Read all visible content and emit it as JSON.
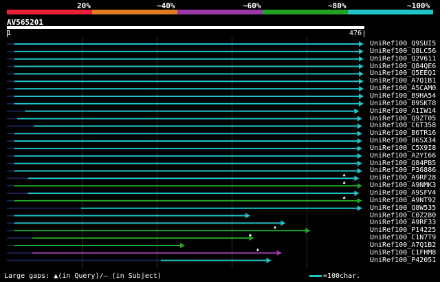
{
  "header": {
    "percent_labels": [
      "20%",
      "~40%",
      "~60%",
      "~80%",
      "~100%"
    ],
    "identity_bar_colors": [
      "#e8203a",
      "#e07a23",
      "#9b3aa6",
      "#23a323",
      "#1fc3c9"
    ]
  },
  "query": {
    "id": "AV565201",
    "start": "1",
    "end": "476"
  },
  "hits": [
    {
      "label": "UniRef100_Q9SUI5",
      "start": 11,
      "end": 476,
      "color": "#1fc3c9",
      "gaps": []
    },
    {
      "label": "UniRef100_Q8LC56",
      "start": 11,
      "end": 476,
      "color": "#1fc3c9",
      "gaps": []
    },
    {
      "label": "UniRef100_Q2V611",
      "start": 11,
      "end": 476,
      "color": "#1fc3c9",
      "gaps": []
    },
    {
      "label": "UniRef100_Q84QE6",
      "start": 11,
      "end": 476,
      "color": "#1fc3c9",
      "gaps": []
    },
    {
      "label": "UniRef100_Q5EEQ1",
      "start": 11,
      "end": 476,
      "color": "#1fc3c9",
      "gaps": []
    },
    {
      "label": "UniRef100_A7Q1B1",
      "start": 11,
      "end": 476,
      "color": "#1fc3c9",
      "gaps": []
    },
    {
      "label": "UniRef100_A5CAM0",
      "start": 11,
      "end": 476,
      "color": "#1fc3c9",
      "gaps": []
    },
    {
      "label": "UniRef100_B9HA54",
      "start": 11,
      "end": 476,
      "color": "#1fc3c9",
      "gaps": []
    },
    {
      "label": "UniRef100_B9SKT8",
      "start": 11,
      "end": 476,
      "color": "#1fc3c9",
      "gaps": []
    },
    {
      "label": "UniRef100_A1IW14",
      "start": 25,
      "end": 470,
      "color": "#1fc3c9",
      "gaps": []
    },
    {
      "label": "UniRef100_Q9ZT05",
      "start": 15,
      "end": 474,
      "color": "#1fc3c9",
      "gaps": []
    },
    {
      "label": "UniRef100_C6T358",
      "start": 37,
      "end": 474,
      "color": "#1fc3c9",
      "gaps": []
    },
    {
      "label": "UniRef100_B6TR16",
      "start": 11,
      "end": 474,
      "color": "#1fc3c9",
      "gaps": []
    },
    {
      "label": "UniRef100_B6SX34",
      "start": 11,
      "end": 474,
      "color": "#1fc3c9",
      "gaps": []
    },
    {
      "label": "UniRef100_C5X9I8",
      "start": 11,
      "end": 474,
      "color": "#1fc3c9",
      "gaps": []
    },
    {
      "label": "UniRef100_A2YI66",
      "start": 11,
      "end": 474,
      "color": "#1fc3c9",
      "gaps": []
    },
    {
      "label": "UniRef100_Q84PB5",
      "start": 11,
      "end": 474,
      "color": "#1fc3c9",
      "gaps": []
    },
    {
      "label": "UniRef100_P36886",
      "start": 11,
      "end": 474,
      "color": "#1fc3c9",
      "gaps": []
    },
    {
      "label": "UniRef100_A9RF28",
      "start": 29,
      "end": 470,
      "color": "#1fc3c9",
      "gaps": [
        450
      ]
    },
    {
      "label": "UniRef100_A9NMK3",
      "start": 11,
      "end": 474,
      "color": "#23a323",
      "gaps": [
        450
      ]
    },
    {
      "label": "UniRef100_A9SFV4",
      "start": 29,
      "end": 470,
      "color": "#1fc3c9",
      "gaps": []
    },
    {
      "label": "UniRef100_A9NT92",
      "start": 11,
      "end": 474,
      "color": "#23a323",
      "gaps": [
        450
      ]
    },
    {
      "label": "UniRef100_Q8W535",
      "start": 100,
      "end": 474,
      "color": "#1fc3c9",
      "gaps": []
    },
    {
      "label": "UniRef100_C0Z280",
      "start": 11,
      "end": 325,
      "color": "#1fc3c9",
      "gaps": []
    },
    {
      "label": "UniRef100_A9RF33",
      "start": 11,
      "end": 372,
      "color": "#1fc3c9",
      "gaps": []
    },
    {
      "label": "UniRef100_P14225",
      "start": 11,
      "end": 405,
      "color": "#23a323",
      "gaps": [
        358
      ]
    },
    {
      "label": "UniRef100_C1N7T9",
      "start": 35,
      "end": 330,
      "color": "#23a323",
      "gaps": [
        325
      ]
    },
    {
      "label": "UniRef100_A7Q1B2",
      "start": 11,
      "end": 238,
      "color": "#23a323",
      "gaps": []
    },
    {
      "label": "UniRef100_C1FHM8",
      "start": 35,
      "end": 367,
      "color": "#9b3aa6",
      "gaps": [
        335
      ]
    },
    {
      "label": "UniRef100_P42051",
      "start": 206,
      "end": 353,
      "color": "#1fc3c9",
      "gaps": []
    }
  ],
  "legend": {
    "gaps_text": "Large gaps: ▲(in Query)/– (in Subject)",
    "scale_text": "=100char."
  }
}
